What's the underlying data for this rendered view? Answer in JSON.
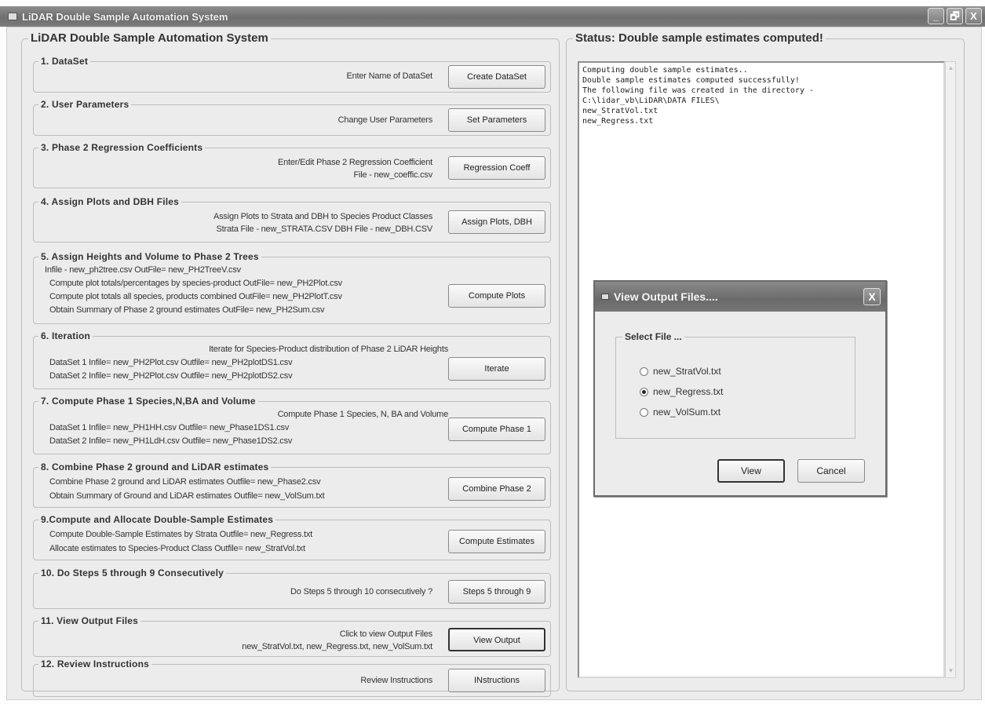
{
  "window": {
    "title": "LiDAR Double Sample Automation System",
    "buttons": [
      "_",
      "🗗",
      "X"
    ]
  },
  "main": {
    "title": "LiDAR Double Sample Automation System",
    "steps": [
      {
        "title": "1. DataSet",
        "lines": [
          "Enter Name of DataSet"
        ],
        "button": "Create DataSet"
      },
      {
        "title": "2. User Parameters",
        "lines": [
          "Change User Parameters"
        ],
        "button": "Set Parameters"
      },
      {
        "title": "3. Phase 2 Regression Coefficients",
        "lines": [
          "Enter/Edit Phase 2 Regression Coefficient",
          "File - new_coeffic.csv"
        ],
        "button": "Regression Coeff"
      },
      {
        "title": "4. Assign Plots and DBH Files",
        "lines": [
          "Assign Plots to Strata and DBH to Species Product Classes",
          "Strata File - new_STRATA.CSV  DBH File - new_DBH.CSV"
        ],
        "button": "Assign Plots, DBH"
      },
      {
        "title": "5. Assign Heights and Volume to Phase 2 Trees",
        "lines": [
          "Infile - new_ph2tree.csv OutFile= new_PH2TreeV.csv",
          "Compute plot totals/percentages by species-product  OutFile=  new_PH2Plot.csv",
          "Compute plot totals all species, products combined    OutFile=  new_PH2PlotT.csv",
          "Obtain Summary of Phase 2 ground estimates              OutFile=  new_PH2Sum.csv"
        ],
        "button": "Compute Plots"
      },
      {
        "title": "6. Iteration",
        "lines": [
          "Iterate for Species-Product distribution of Phase 2 LiDAR Heights",
          "DataSet 1   Infile= new_PH2Plot.csv   Outfile= new_PH2plotDS1.csv",
          "DataSet 2   Infile= new_PH2Plot.csv   Outfile= new_PH2plotDS2.csv"
        ],
        "button": "Iterate"
      },
      {
        "title": "7. Compute Phase 1 Species,N,BA and Volume",
        "lines": [
          "Compute Phase 1 Species, N, BA and Volume",
          "DataSet 1   Infile= new_PH1HH.csv   Outfile= new_Phase1DS1.csv",
          "DataSet 2   Infile= new_PH1LdH.csv   Outfile= new_Phase1DS2.csv"
        ],
        "button": "Compute Phase 1"
      },
      {
        "title": "8. Combine Phase 2 ground and LiDAR estimates",
        "lines": [
          "Combine Phase 2 ground and LiDAR estimates   Outfile= new_Phase2.csv",
          "Obtain Summary of Ground and LiDAR estimates  Outfile= new_VolSum.txt"
        ],
        "button": "Combine Phase 2"
      },
      {
        "title": "9.Compute and Allocate Double-Sample Estimates",
        "lines": [
          "Compute Double-Sample Estimates by Strata  Outfile= new_Regress.txt",
          "Allocate estimates to Species-Product Class   Outfile= new_StratVol.txt"
        ],
        "button": "Compute Estimates"
      },
      {
        "title": "10. Do Steps 5 through 9 Consecutively",
        "lines": [
          "Do Steps 5 through 10 consecutively ?"
        ],
        "button": "Steps 5 through 9"
      },
      {
        "title": "11. View Output Files",
        "lines": [
          "Click to view Output Files",
          "new_StratVol.txt, new_Regress.txt, new_VolSum.txt"
        ],
        "button": "View Output"
      },
      {
        "title": "12. Review Instructions",
        "lines": [
          "Review Instructions"
        ],
        "button": "INstructions"
      }
    ]
  },
  "status": {
    "title": "Status: Double sample estimates computed!",
    "log": [
      "Computing double sample estimates..",
      "Double sample estimates computed successfully!",
      "The following file was created in the directory -",
      "C:\\lidar_vb\\LiDAR\\DATA FILES\\",
      "new_StratVol.txt",
      "new_Regress.txt"
    ]
  },
  "dialog": {
    "title": "View Output Files....",
    "close": "X",
    "group_title": "Select File ...",
    "options": [
      {
        "label": "new_StratVol.txt",
        "checked": false
      },
      {
        "label": "new_Regress.txt",
        "checked": true
      },
      {
        "label": "new_VolSum.txt",
        "checked": false
      }
    ],
    "view_button": "View",
    "cancel_button": "Cancel"
  }
}
